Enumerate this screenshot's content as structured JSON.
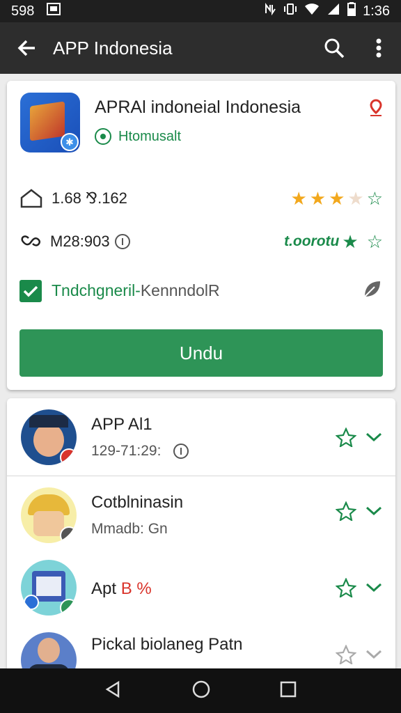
{
  "status": {
    "left_number": "598",
    "time": "1:36"
  },
  "appbar": {
    "title": "APP Indonesia"
  },
  "app": {
    "name": "APRAl indoneial Indonesia",
    "developer": "Htomusalt",
    "developer_badge": "R",
    "downloads": "1.68 ⅋.162",
    "rating_stars": 3.5,
    "size": "M28:903",
    "reviews_label": "t.oorotu",
    "category_a": "Tndchgneril-",
    "category_b": " KennndolR",
    "install_label": "Undu"
  },
  "list": [
    {
      "title": "APP Al1",
      "subtitle": "129-71:29:"
    },
    {
      "title": "Cotblninasin",
      "subtitle": "Mmadb: Gn"
    },
    {
      "title": "Apt",
      "title_accent": "B %",
      "subtitle": ""
    },
    {
      "title": "Pickal biolaneg Patn",
      "subtitle": ""
    }
  ],
  "colors": {
    "accent": "#2e9457",
    "star_gold": "#f2a81d",
    "appbar": "#2d2d2d"
  },
  "icons": [
    "back-arrow-icon",
    "search-icon",
    "more-vert-icon",
    "home-icon",
    "link-icon",
    "info-icon",
    "leaf-icon",
    "location-pin-icon"
  ]
}
